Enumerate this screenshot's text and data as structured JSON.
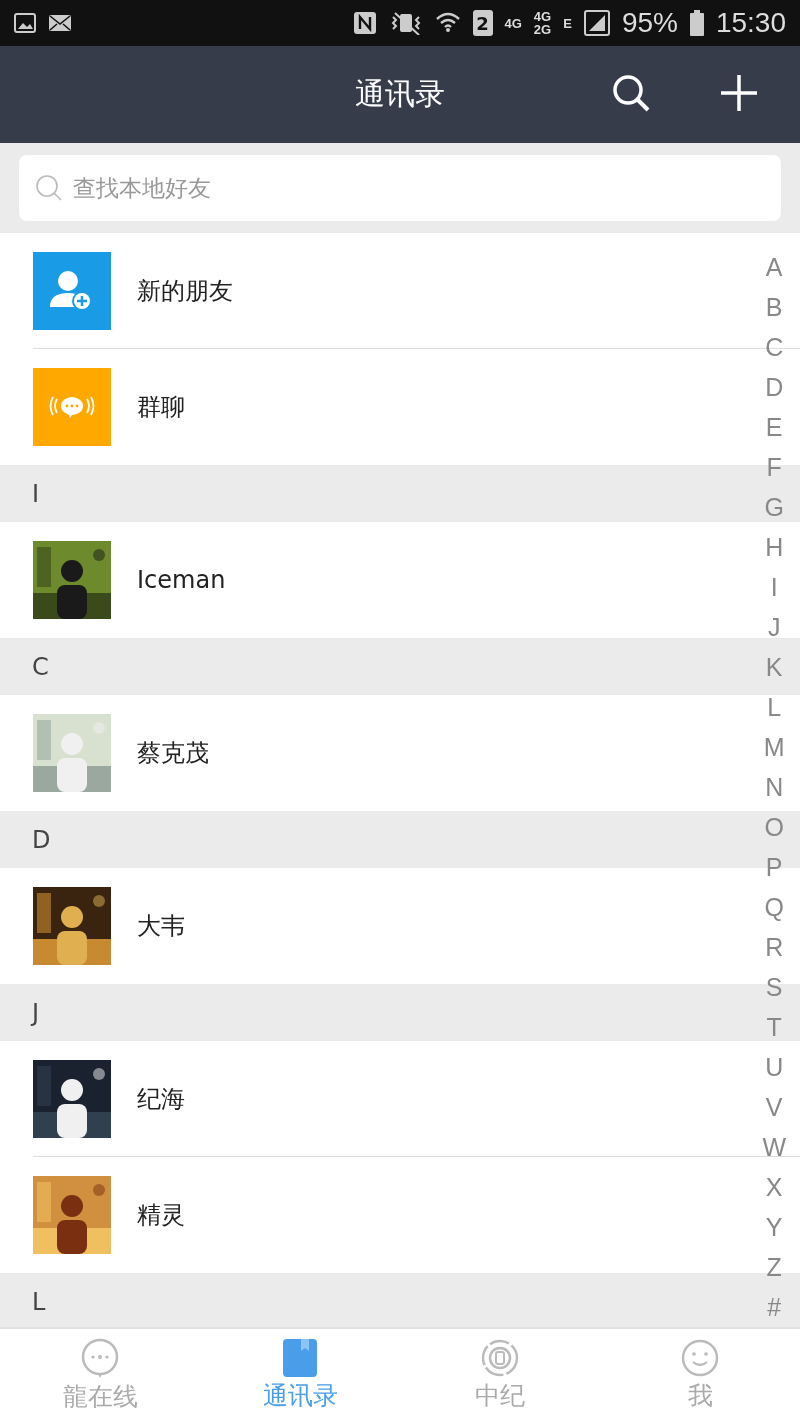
{
  "status_bar": {
    "sim_badge": "2",
    "network_a": "4G",
    "network_b_top": "4G",
    "network_b_bottom": "2G",
    "network_c": "E",
    "battery": "95%",
    "time": "15:30"
  },
  "header": {
    "title": "通讯录"
  },
  "search": {
    "placeholder": "查找本地好友"
  },
  "entries": [
    {
      "kind": "new_friends",
      "label": "新的朋友"
    },
    {
      "kind": "group_chat",
      "label": "群聊"
    }
  ],
  "sections": [
    {
      "letter": "I",
      "contacts": [
        {
          "name": "Iceman"
        }
      ]
    },
    {
      "letter": "C",
      "contacts": [
        {
          "name": "蔡克茂"
        }
      ]
    },
    {
      "letter": "D",
      "contacts": [
        {
          "name": "大韦"
        }
      ]
    },
    {
      "letter": "J",
      "contacts": [
        {
          "name": "纪海"
        },
        {
          "name": "精灵"
        }
      ]
    },
    {
      "letter": "L"
    }
  ],
  "index": [
    "A",
    "B",
    "C",
    "D",
    "E",
    "F",
    "G",
    "H",
    "I",
    "J",
    "K",
    "L",
    "M",
    "N",
    "O",
    "P",
    "Q",
    "R",
    "S",
    "T",
    "U",
    "V",
    "W",
    "X",
    "Y",
    "Z",
    "#"
  ],
  "tabs": [
    {
      "kind": "chat",
      "label": "龍在线",
      "selected": false
    },
    {
      "kind": "book",
      "label": "通讯录",
      "selected": true
    },
    {
      "kind": "coin",
      "label": "中纪",
      "selected": false
    },
    {
      "kind": "smile",
      "label": "我",
      "selected": false
    }
  ]
}
